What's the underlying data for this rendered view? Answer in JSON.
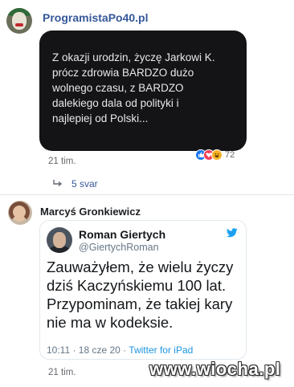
{
  "comment1": {
    "author": "ProgramistaPo40.pl",
    "text": "Z okazji urodzin, życzę Jarkowi K.\nprócz zdrowia BARDZO dużo\nwolnego czasu, z BARDZO\ndalekiego dala od polityki i\nnajlepiej od Polski...",
    "reactions": {
      "icons": [
        "like-icon",
        "love-icon",
        "haha-icon"
      ],
      "count": "72"
    },
    "time": "21 tim.",
    "replies_label": "5 svar"
  },
  "comment2": {
    "author": "Marcyś Gronkiewicz",
    "time": "21 tim.",
    "tweet": {
      "name": "Roman Giertych",
      "handle": "@GiertychRoman",
      "text": "Zauważyłem, że wielu życzy\ndziś Kaczyńskiemu 100 lat.\nPrzypominam, że takiej kary\nnie ma w kodeksie.",
      "time": "10:11 · 18 cze 20 · ",
      "source": "Twitter for iPad",
      "logo": "twitter-bird-icon"
    }
  },
  "watermark": "www.wiocha.pl",
  "colors": {
    "link": "#365899",
    "bubble": "#141416",
    "like": "#1877f2",
    "twitter": "#1da1f2"
  }
}
